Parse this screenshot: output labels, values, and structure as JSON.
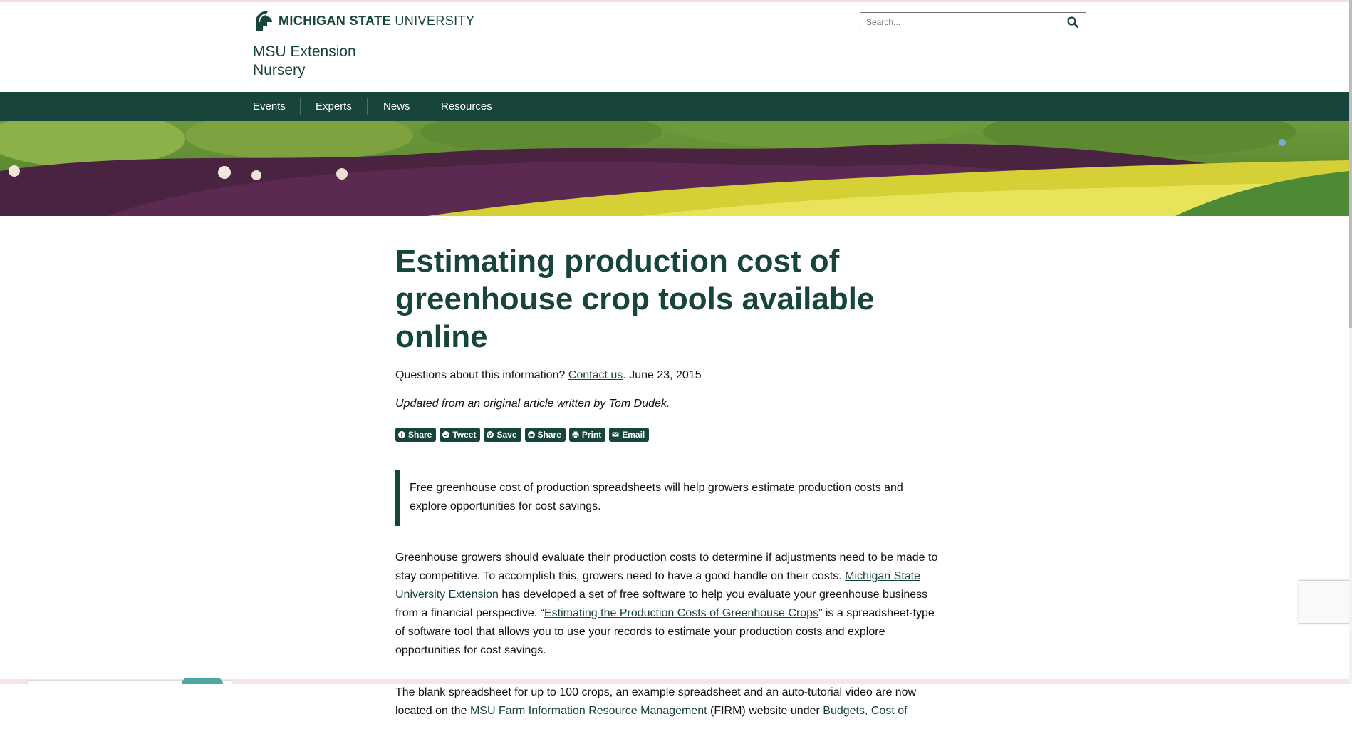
{
  "header": {
    "logo_bold": "MICHIGAN STATE",
    "logo_light": "UNIVERSITY",
    "site_title": "MSU Extension",
    "site_subtitle": "Nursery",
    "search_placeholder": "Search..."
  },
  "nav": {
    "items": [
      {
        "label": "Events"
      },
      {
        "label": "Experts"
      },
      {
        "label": "News"
      },
      {
        "label": "Resources"
      }
    ]
  },
  "article": {
    "title": "Estimating production cost of greenhouse crop tools available online",
    "meta_question": "Questions about this information? ",
    "contact_link": "Contact us",
    "date": ". June 23, 2015",
    "byline": "Updated from an original article written by Tom Dudek.",
    "share_buttons": [
      {
        "label": "Share",
        "icon": "facebook-icon"
      },
      {
        "label": "Tweet",
        "icon": "twitter-icon"
      },
      {
        "label": "Save",
        "icon": "pinterest-icon"
      },
      {
        "label": "Share",
        "icon": "linkedin-icon"
      },
      {
        "label": "Print",
        "icon": "print-icon"
      },
      {
        "label": "Email",
        "icon": "email-icon"
      }
    ],
    "summary": "Free greenhouse cost of production spreadsheets will help growers estimate production costs and explore opportunities for cost savings.",
    "p1": {
      "t1": "Greenhouse growers should evaluate their production costs to determine if adjustments need to be made to stay competitive. To accomplish this, growers need to have a good handle on their costs. ",
      "link1": "Michigan State University Extension",
      "t2": " has developed a set of free software to help you evaluate your greenhouse business from a financial perspective. “",
      "link2": "Estimating the Production Costs of Greenhouse Crops",
      "t3": "” is a spreadsheet-type of software tool that allows you to use your records to estimate your production costs and explore opportunities for cost savings."
    },
    "p2": {
      "t1": "The blank spreadsheet for up to 100 crops, an example spreadsheet and an auto-tutorial video are now located on the ",
      "link1": "MSU Farm Information Resource Management",
      "t2": " (FIRM) website under ",
      "link2": "Budgets, Cost of"
    }
  },
  "colors": {
    "brand_green": "#18453b",
    "nav_text": "#ffffff",
    "body_text": "#111111"
  }
}
